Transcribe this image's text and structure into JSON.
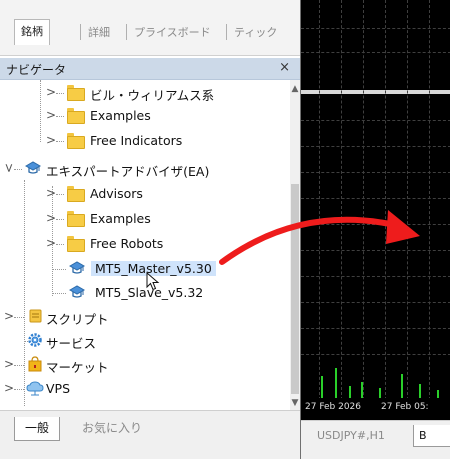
{
  "top_tabs": [
    "銘柄",
    "詳細",
    "プライスボード",
    "ティック"
  ],
  "navigator": {
    "title": "ナビゲータ",
    "close": "×"
  },
  "tree": {
    "bill_williams": "ビル・ウィリアムス系",
    "examples_ind": "Examples",
    "free_indicators": "Free Indicators",
    "expert_advisors": "エキスパートアドバイザ(EA)",
    "advisors": "Advisors",
    "examples_ea": "Examples",
    "free_robots": "Free Robots",
    "mt5_master": "MT5_Master_v5.30",
    "mt5_slave": "MT5_Slave_v5.32",
    "scripts": "スクリプト",
    "services": "サービス",
    "market": "マーケット",
    "vps": "VPS"
  },
  "bottom_tabs": [
    "一般",
    "お気に入り"
  ],
  "chart": {
    "time_labels": [
      "27 Feb 2026",
      "27 Feb 05:"
    ],
    "tabs": [
      "USDJPY#,H1",
      "B"
    ]
  },
  "colors": {
    "folder": "#f7cc45",
    "selected": "#cfe3fb",
    "arrow": "#ee1c1c",
    "volume": "#2ad02a"
  },
  "icons": {
    "folder": "folder-icon",
    "ea": "expert-advisor-icon",
    "script": "script-icon",
    "service": "gear-icon",
    "market": "shopping-bag-icon",
    "vps": "cloud-icon"
  }
}
